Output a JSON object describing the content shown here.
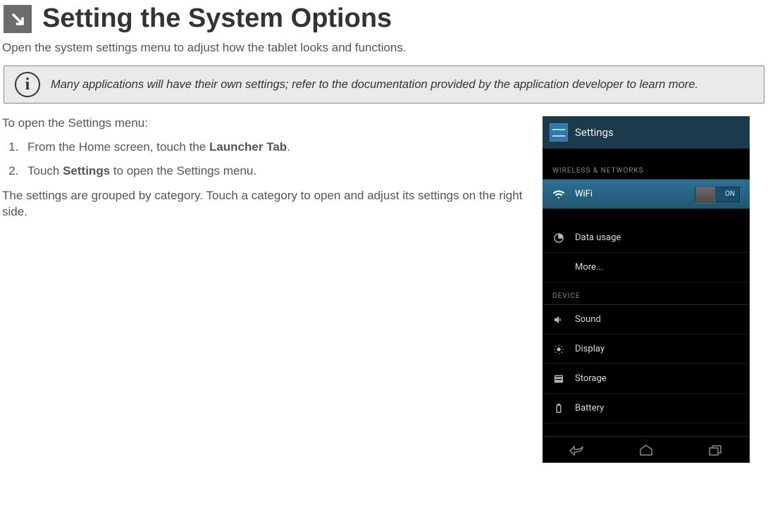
{
  "header": {
    "title": "Setting the System Options"
  },
  "intro": "Open the system settings menu to adjust how the tablet looks and functions.",
  "info_box": {
    "text": "Many applications will have their own settings; refer to the documentation provided by the application developer to learn more."
  },
  "steps_heading": "To open the Settings menu:",
  "steps": {
    "item1_pre": "From the Home screen, touch the ",
    "item1_bold": "Launcher Tab",
    "item1_post": ".",
    "item2_pre": "Touch ",
    "item2_bold": "Settings",
    "item2_post": " to open the Settings menu."
  },
  "post_steps": "The settings are grouped by category. Touch a category to open and adjust its settings on the right side.",
  "screenshot": {
    "title": "Settings",
    "section1": "WIRELESS & NETWORKS",
    "section2": "DEVICE",
    "wifi": {
      "label": "WiFi",
      "toggle": "ON"
    },
    "data_usage": "Data usage",
    "more": "More...",
    "sound": "Sound",
    "display": "Display",
    "storage": "Storage",
    "battery": "Battery"
  }
}
